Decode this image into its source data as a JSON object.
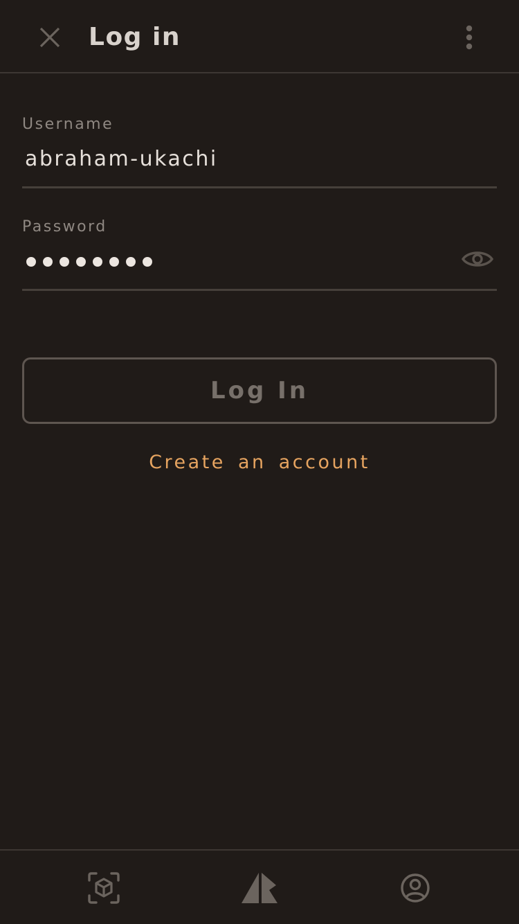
{
  "header": {
    "title": "Log in",
    "close_icon": "close-icon",
    "more_icon": "more-vertical-icon"
  },
  "form": {
    "username": {
      "label": "Username",
      "value": "abraham-ukachi"
    },
    "password": {
      "label": "Password",
      "masked_length": 8,
      "visibility_icon": "eye-icon"
    },
    "submit_label": "Log In",
    "create_account_label": "Create an account"
  },
  "bottom_nav": {
    "items": [
      {
        "icon": "ar-cube-icon"
      },
      {
        "icon": "logo-icon"
      },
      {
        "icon": "account-circle-icon"
      }
    ]
  },
  "colors": {
    "background": "#201b18",
    "accent": "#e6a460",
    "divider": "#3d3733"
  }
}
